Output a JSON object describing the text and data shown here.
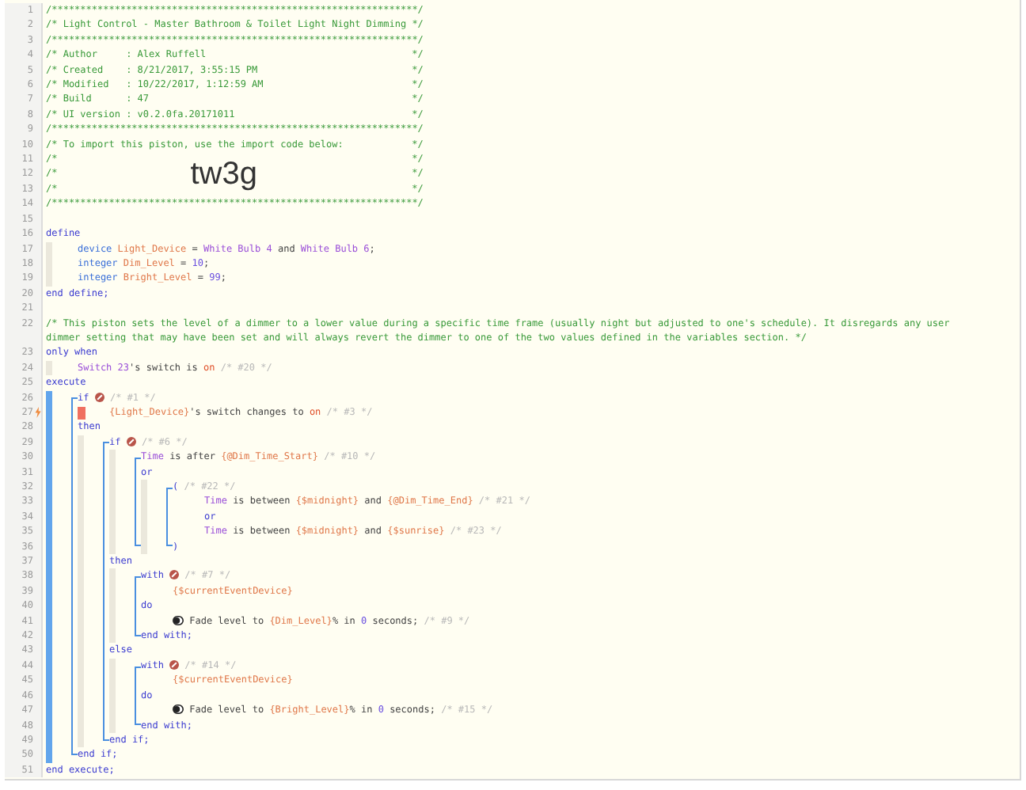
{
  "lines": [
    {
      "number": "1",
      "flag": false,
      "tokens": [
        {
          "kind": "comment",
          "text": "/****************************************************************/"
        }
      ]
    },
    {
      "number": "2",
      "flag": false,
      "tokens": [
        {
          "kind": "comment",
          "text": "/* Light Control - Master Bathroom & Toilet Light Night Dimming */"
        }
      ]
    },
    {
      "number": "3",
      "flag": false,
      "tokens": [
        {
          "kind": "comment",
          "text": "/****************************************************************/"
        }
      ]
    },
    {
      "number": "4",
      "flag": false,
      "tokens": [
        {
          "kind": "comment",
          "text": "/* Author     : Alex Ruffell"
        },
        {
          "kind": "comment-end",
          "text": "*/"
        }
      ]
    },
    {
      "number": "5",
      "flag": false,
      "tokens": [
        {
          "kind": "comment",
          "text": "/* Created    : 8/21/2017, 3:55:15 PM"
        },
        {
          "kind": "comment-end",
          "text": "*/"
        }
      ]
    },
    {
      "number": "6",
      "flag": false,
      "tokens": [
        {
          "kind": "comment",
          "text": "/* Modified   : 10/22/2017, 1:12:59 AM"
        },
        {
          "kind": "comment-end",
          "text": "*/"
        }
      ]
    },
    {
      "number": "7",
      "flag": false,
      "tokens": [
        {
          "kind": "comment",
          "text": "/* Build      : 47"
        },
        {
          "kind": "comment-end",
          "text": "*/"
        }
      ]
    },
    {
      "number": "8",
      "flag": false,
      "tokens": [
        {
          "kind": "comment",
          "text": "/* UI version : v0.2.0fa.20171011"
        },
        {
          "kind": "comment-end",
          "text": "*/"
        }
      ]
    },
    {
      "number": "9",
      "flag": false,
      "tokens": [
        {
          "kind": "comment",
          "text": "/****************************************************************/"
        }
      ]
    },
    {
      "number": "10",
      "flag": false,
      "tokens": [
        {
          "kind": "comment",
          "text": "/* To import this piston, use the import code below:"
        },
        {
          "kind": "comment-end",
          "text": "*/"
        }
      ]
    },
    {
      "number": "11",
      "flag": false,
      "tokens": [
        {
          "kind": "comment",
          "text": "/*"
        },
        {
          "kind": "comment-end",
          "text": "*/"
        }
      ]
    },
    {
      "number": "12",
      "flag": false,
      "tokens": [
        {
          "kind": "comment",
          "text": "/*"
        },
        {
          "kind": "code",
          "text": "tw3g"
        },
        {
          "kind": "comment-end",
          "text": "*/"
        }
      ]
    },
    {
      "number": "13",
      "flag": false,
      "tokens": [
        {
          "kind": "comment",
          "text": "/*"
        },
        {
          "kind": "comment-end",
          "text": "*/"
        }
      ]
    },
    {
      "number": "14",
      "flag": false,
      "tokens": [
        {
          "kind": "comment",
          "text": "/****************************************************************/"
        }
      ]
    },
    {
      "number": "15",
      "flag": false
    },
    {
      "number": "16",
      "flag": false,
      "tokens": [
        {
          "kind": "keyword",
          "text": "define"
        }
      ]
    },
    {
      "number": "17",
      "flag": false,
      "guides": [
        {
          "kind": "shade"
        }
      ],
      "tokens": [
        {
          "kind": "type",
          "text": "device"
        },
        {
          "kind": "variable",
          "text": " Light_Device"
        },
        {
          "kind": "text",
          "text": " = "
        },
        {
          "kind": "device",
          "text": "White Bulb 4"
        },
        {
          "kind": "text",
          "text": " and "
        },
        {
          "kind": "device",
          "text": "White Bulb 6"
        },
        {
          "kind": "text",
          "text": ";"
        }
      ]
    },
    {
      "number": "18",
      "flag": false,
      "guides": [
        {
          "kind": "shade"
        }
      ],
      "tokens": [
        {
          "kind": "type",
          "text": "integer"
        },
        {
          "kind": "variable",
          "text": " Dim_Level"
        },
        {
          "kind": "text",
          "text": " = "
        },
        {
          "kind": "number",
          "text": "10"
        },
        {
          "kind": "text",
          "text": ";"
        }
      ]
    },
    {
      "number": "19",
      "flag": false,
      "guides": [
        {
          "kind": "shade"
        }
      ],
      "tokens": [
        {
          "kind": "type",
          "text": "integer"
        },
        {
          "kind": "variable",
          "text": " Bright_Level"
        },
        {
          "kind": "text",
          "text": " = "
        },
        {
          "kind": "number",
          "text": "99"
        },
        {
          "kind": "text",
          "text": ";"
        }
      ]
    },
    {
      "number": "20",
      "flag": false,
      "tokens": [
        {
          "kind": "keyword",
          "text": "end define;"
        }
      ]
    },
    {
      "number": "21",
      "flag": false
    },
    {
      "number": "22",
      "flag": false,
      "tokens": [
        {
          "kind": "comment",
          "text": "/* This piston sets the level of a dimmer to a lower value during a specific time frame (usually night but adjusted to one's schedule). It disregards any user dimmer setting that may have been set and will always revert the dimmer to one of the two values defined in the variables section. */"
        }
      ]
    },
    {
      "number": "23",
      "flag": false,
      "tokens": [
        {
          "kind": "keyword",
          "text": "only when"
        }
      ]
    },
    {
      "number": "24",
      "flag": false,
      "guides": [
        {
          "kind": "shade"
        }
      ],
      "tokens": [
        {
          "kind": "device",
          "text": "Switch 23"
        },
        {
          "kind": "text",
          "text": "'s switch is "
        },
        {
          "kind": "value",
          "text": "on"
        },
        {
          "kind": "note",
          "text": " /* #20 */"
        }
      ]
    },
    {
      "number": "25",
      "flag": false,
      "tokens": [
        {
          "kind": "keyword",
          "text": "execute"
        }
      ]
    },
    {
      "number": "26",
      "flag": false,
      "guides": [
        {
          "kind": "bar-top"
        }
      ],
      "tokens": [
        {
          "kind": "keyword",
          "text": "if "
        },
        {
          "kind": "badge"
        },
        {
          "kind": "note",
          "text": " /* #1 */"
        }
      ]
    },
    {
      "number": "27",
      "flag": true,
      "guides": [
        {
          "kind": "bar-line"
        },
        {
          "kind": "mark"
        }
      ],
      "tokens": [
        {
          "kind": "variable",
          "text": "{Light_Device}"
        },
        {
          "kind": "text",
          "text": "'s switch changes to "
        },
        {
          "kind": "value",
          "text": "on"
        },
        {
          "kind": "note",
          "text": " /* #3 */"
        }
      ]
    },
    {
      "number": "28",
      "flag": false,
      "guides": [
        {
          "kind": "bar-line"
        }
      ],
      "tokens": [
        {
          "kind": "keyword",
          "text": "then"
        }
      ]
    },
    {
      "number": "29",
      "flag": false,
      "guides": [
        {
          "kind": "bar-line"
        },
        {
          "kind": "shade-top"
        }
      ],
      "tokens": [
        {
          "kind": "keyword",
          "text": "if "
        },
        {
          "kind": "badge"
        },
        {
          "kind": "note",
          "text": " /* #6 */"
        }
      ]
    },
    {
      "number": "30",
      "flag": false,
      "guides": [
        {
          "kind": "bar-line"
        },
        {
          "kind": "shade-line"
        },
        {
          "kind": "shade-top"
        }
      ],
      "tokens": [
        {
          "kind": "device",
          "text": "Time"
        },
        {
          "kind": "text",
          "text": " is after "
        },
        {
          "kind": "variable",
          "text": "{@Dim_Time_Start}"
        },
        {
          "kind": "note",
          "text": " /* #10 */"
        }
      ]
    },
    {
      "number": "31",
      "flag": false,
      "guides": [
        {
          "kind": "bar-line"
        },
        {
          "kind": "shade-line"
        },
        {
          "kind": "shade-line"
        }
      ],
      "tokens": [
        {
          "kind": "keyword",
          "text": "or"
        }
      ]
    },
    {
      "number": "32",
      "flag": false,
      "guides": [
        {
          "kind": "bar-line"
        },
        {
          "kind": "shade-line"
        },
        {
          "kind": "shade-line"
        },
        {
          "kind": "shade-top"
        }
      ],
      "tokens": [
        {
          "kind": "keyword",
          "text": "("
        },
        {
          "kind": "note",
          "text": " /* #22 */"
        }
      ]
    },
    {
      "number": "33",
      "flag": false,
      "guides": [
        {
          "kind": "bar-line"
        },
        {
          "kind": "shade-line"
        },
        {
          "kind": "shade-line"
        },
        {
          "kind": "shade-line"
        },
        {
          "kind": "blank"
        }
      ],
      "tokens": [
        {
          "kind": "device",
          "text": "Time"
        },
        {
          "kind": "text",
          "text": " is between "
        },
        {
          "kind": "variable",
          "text": "{$midnight}"
        },
        {
          "kind": "text",
          "text": " and "
        },
        {
          "kind": "variable",
          "text": "{@Dim_Time_End}"
        },
        {
          "kind": "note",
          "text": " /* #21 */"
        }
      ]
    },
    {
      "number": "34",
      "flag": false,
      "guides": [
        {
          "kind": "bar-line"
        },
        {
          "kind": "shade-line"
        },
        {
          "kind": "shade-line"
        },
        {
          "kind": "shade-line"
        },
        {
          "kind": "blank"
        }
      ],
      "tokens": [
        {
          "kind": "keyword",
          "text": "or"
        }
      ]
    },
    {
      "number": "35",
      "flag": false,
      "guides": [
        {
          "kind": "bar-line"
        },
        {
          "kind": "shade-line"
        },
        {
          "kind": "shade-line"
        },
        {
          "kind": "shade-line"
        },
        {
          "kind": "blank"
        }
      ],
      "tokens": [
        {
          "kind": "device",
          "text": "Time"
        },
        {
          "kind": "text",
          "text": " is between "
        },
        {
          "kind": "variable",
          "text": "{$midnight}"
        },
        {
          "kind": "text",
          "text": " and "
        },
        {
          "kind": "variable",
          "text": "{$sunrise}"
        },
        {
          "kind": "note",
          "text": " /* #23 */"
        }
      ]
    },
    {
      "number": "36",
      "flag": false,
      "guides": [
        {
          "kind": "bar-line"
        },
        {
          "kind": "shade-line"
        },
        {
          "kind": "shade-bottom"
        },
        {
          "kind": "shade-bottom"
        }
      ],
      "tokens": [
        {
          "kind": "keyword",
          "text": ")"
        }
      ]
    },
    {
      "number": "37",
      "flag": false,
      "guides": [
        {
          "kind": "bar-line"
        },
        {
          "kind": "shade-line"
        }
      ],
      "tokens": [
        {
          "kind": "keyword",
          "text": "then"
        }
      ]
    },
    {
      "number": "38",
      "flag": false,
      "guides": [
        {
          "kind": "bar-line"
        },
        {
          "kind": "shade-line"
        },
        {
          "kind": "shade-top"
        }
      ],
      "tokens": [
        {
          "kind": "keyword",
          "text": "with "
        },
        {
          "kind": "badge"
        },
        {
          "kind": "note",
          "text": " /* #7 */"
        }
      ]
    },
    {
      "number": "39",
      "flag": false,
      "guides": [
        {
          "kind": "bar-line"
        },
        {
          "kind": "shade-line"
        },
        {
          "kind": "shade-line"
        },
        {
          "kind": "blank"
        }
      ],
      "tokens": [
        {
          "kind": "variable",
          "text": "{$currentEventDevice}"
        }
      ]
    },
    {
      "number": "40",
      "flag": false,
      "guides": [
        {
          "kind": "bar-line"
        },
        {
          "kind": "shade-line"
        },
        {
          "kind": "shade-line"
        }
      ],
      "tokens": [
        {
          "kind": "keyword",
          "text": "do"
        }
      ]
    },
    {
      "number": "41",
      "flag": false,
      "guides": [
        {
          "kind": "bar-line"
        },
        {
          "kind": "shade-line"
        },
        {
          "kind": "shade-line"
        },
        {
          "kind": "blank"
        }
      ],
      "tokens": [
        {
          "kind": "toggle"
        },
        {
          "kind": "text",
          "text": " Fade level to "
        },
        {
          "kind": "variable",
          "text": "{Dim_Level}"
        },
        {
          "kind": "text",
          "text": "% in "
        },
        {
          "kind": "number",
          "text": "0"
        },
        {
          "kind": "text",
          "text": " seconds;"
        },
        {
          "kind": "note",
          "text": " /* #9 */"
        }
      ]
    },
    {
      "number": "42",
      "flag": false,
      "guides": [
        {
          "kind": "bar-line"
        },
        {
          "kind": "shade-line"
        },
        {
          "kind": "shade-bottom"
        }
      ],
      "tokens": [
        {
          "kind": "keyword",
          "text": "end with;"
        }
      ]
    },
    {
      "number": "43",
      "flag": false,
      "guides": [
        {
          "kind": "bar-line"
        },
        {
          "kind": "shade-line"
        }
      ],
      "tokens": [
        {
          "kind": "keyword",
          "text": "else"
        }
      ]
    },
    {
      "number": "44",
      "flag": false,
      "guides": [
        {
          "kind": "bar-line"
        },
        {
          "kind": "shade-line"
        },
        {
          "kind": "shade-top"
        }
      ],
      "tokens": [
        {
          "kind": "keyword",
          "text": "with "
        },
        {
          "kind": "badge"
        },
        {
          "kind": "note",
          "text": " /* #14 */"
        }
      ]
    },
    {
      "number": "45",
      "flag": false,
      "guides": [
        {
          "kind": "bar-line"
        },
        {
          "kind": "shade-line"
        },
        {
          "kind": "shade-line"
        },
        {
          "kind": "blank"
        }
      ],
      "tokens": [
        {
          "kind": "variable",
          "text": "{$currentEventDevice}"
        }
      ]
    },
    {
      "number": "46",
      "flag": false,
      "guides": [
        {
          "kind": "bar-line"
        },
        {
          "kind": "shade-line"
        },
        {
          "kind": "shade-line"
        }
      ],
      "tokens": [
        {
          "kind": "keyword",
          "text": "do"
        }
      ]
    },
    {
      "number": "47",
      "flag": false,
      "guides": [
        {
          "kind": "bar-line"
        },
        {
          "kind": "shade-line"
        },
        {
          "kind": "shade-line"
        },
        {
          "kind": "blank"
        }
      ],
      "tokens": [
        {
          "kind": "toggle"
        },
        {
          "kind": "text",
          "text": " Fade level to "
        },
        {
          "kind": "variable",
          "text": "{Bright_Level}"
        },
        {
          "kind": "text",
          "text": "% in "
        },
        {
          "kind": "number",
          "text": "0"
        },
        {
          "kind": "text",
          "text": " seconds;"
        },
        {
          "kind": "note",
          "text": " /* #15 */"
        }
      ]
    },
    {
      "number": "48",
      "flag": false,
      "guides": [
        {
          "kind": "bar-line"
        },
        {
          "kind": "shade-line"
        },
        {
          "kind": "shade-bottom"
        }
      ],
      "tokens": [
        {
          "kind": "keyword",
          "text": "end with;"
        }
      ]
    },
    {
      "number": "49",
      "flag": false,
      "guides": [
        {
          "kind": "bar-line"
        },
        {
          "kind": "shade-bottom"
        }
      ],
      "tokens": [
        {
          "kind": "keyword",
          "text": "end if;"
        }
      ]
    },
    {
      "number": "50",
      "flag": false,
      "guides": [
        {
          "kind": "bar-bottom"
        }
      ],
      "tokens": [
        {
          "kind": "keyword",
          "text": "end if;"
        }
      ]
    },
    {
      "number": "51",
      "flag": false,
      "tokens": [
        {
          "kind": "keyword",
          "text": "end execute;"
        }
      ]
    }
  ]
}
